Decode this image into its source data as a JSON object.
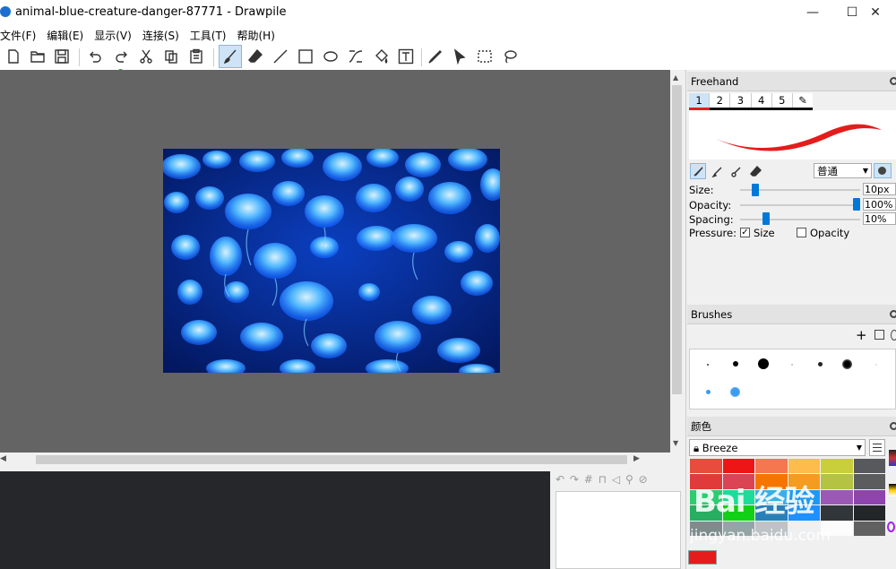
{
  "window": {
    "title": "animal-blue-creature-danger-87771 - Drawpile",
    "minimize": "—",
    "maximize": "☐",
    "close": "✕"
  },
  "menu": [
    "文件(F)",
    "编辑(E)",
    "显示(V)",
    "连接(S)",
    "工具(T)",
    "帮助(H)"
  ],
  "toolbar": {
    "icons": [
      "new-file-icon",
      "open-folder-icon",
      "save-icon",
      "undo-icon",
      "redo-icon",
      "cut-icon",
      "copy-icon",
      "paste-icon",
      "brush-icon",
      "eraser-icon",
      "line-icon",
      "rectangle-icon",
      "ellipse-icon",
      "bezier-icon",
      "fill-icon",
      "text-icon",
      "color-picker-icon",
      "selection-move-icon",
      "rect-select-icon",
      "lasso-icon"
    ],
    "active": "brush-icon"
  },
  "tool_settings": {
    "title": "Freehand",
    "slots": [
      "1",
      "2",
      "3",
      "4",
      "5"
    ],
    "active_slot": "1",
    "blend_mode": "普通",
    "size_label": "Size:",
    "size_value": "10px",
    "size_level": 0.1,
    "opacity_label": "Opacity:",
    "opacity_value": "100%",
    "opacity_level": 1.0,
    "spacing_label": "Spacing:",
    "spacing_value": "10%",
    "spacing_level": 0.2,
    "pressure_label": "Pressure:",
    "pressure_size_label": "Size",
    "pressure_size_checked": true,
    "pressure_opacity_label": "Opacity",
    "pressure_opacity_checked": false,
    "stroke_color": "#e41c1c"
  },
  "brushes": {
    "title": "Brushes"
  },
  "color_panel": {
    "title": "颜色",
    "palette_name": "Breeze",
    "current_color": "#e41c1c",
    "swatches": [
      "#e74c3c",
      "#ed1515",
      "#f47750",
      "#fdbc4b",
      "#c9ce3b",
      "#58595c",
      "#e03a3a",
      "#da4453",
      "#f67400",
      "#f39c1f",
      "#b4c342",
      "#5a5c5d",
      "#2ecc71",
      "#1cdc9a",
      "#3daee9",
      "#1d99f3",
      "#9b59b6",
      "#8e44ad",
      "#27ae60",
      "#11d116",
      "#2980b9",
      "#1e90ff",
      "#31363b",
      "#232629",
      "#7f8c8d",
      "#95a5a6",
      "#bdc3c7",
      "#eff0f1",
      "#fcfcfc",
      "#616161"
    ]
  },
  "watermark": {
    "brand": "Bai 经验",
    "url": "jingyan.baidu.com"
  }
}
